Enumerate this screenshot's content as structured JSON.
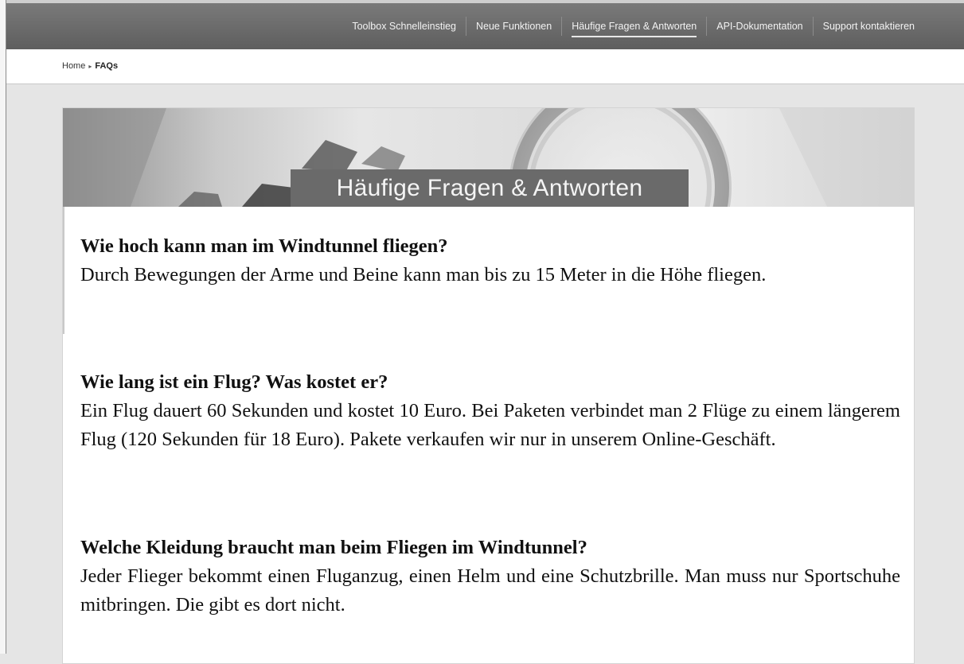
{
  "nav": {
    "items": [
      {
        "label": "Toolbox Schnelleinstieg"
      },
      {
        "label": "Neue Funktionen"
      },
      {
        "label": "Häufige Fragen & Antworten"
      },
      {
        "label": "API-Dokumentation"
      },
      {
        "label": "Support kontaktieren"
      }
    ],
    "active_index": 2
  },
  "breadcrumb": {
    "home": "Home",
    "separator": "▸",
    "current": "FAQs"
  },
  "banner": {
    "title": "Häufige Fragen & Antworten"
  },
  "faqs": [
    {
      "question": "Wie hoch kann man im Windtunnel fliegen?",
      "answer": "Durch Bewegungen der Arme und Beine kann man bis zu 15 Meter in die Höhe fliegen."
    },
    {
      "question": "Wie lang ist ein Flug? Was kostet er?",
      "answer": "Ein Flug dauert 60 Sekunden und kostet 10 Euro. Bei Paketen verbindet man 2 Flüge zu einem längerem Flug (120 Sekunden für 18 Euro). Pakete verkaufen wir nur in unserem Online-Geschäft."
    },
    {
      "question": "Welche Kleidung braucht man beim Fliegen im Windtunnel?",
      "answer": "Jeder Flieger bekommt einen Fluganzug, einen Helm und eine Schutzbrille. Man muss nur Sportschuhe mitbringen. Die gibt es dort nicht."
    }
  ]
}
